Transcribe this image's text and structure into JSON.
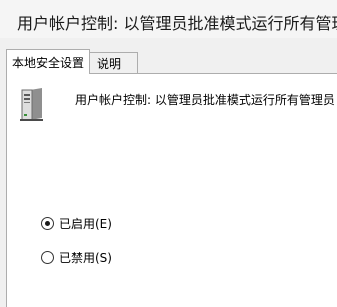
{
  "window": {
    "title": "用户帐户控制: 以管理员批准模式运行所有管理员"
  },
  "tabs": [
    {
      "label": "本地安全设置",
      "selected": true
    },
    {
      "label": "说明",
      "selected": false
    }
  ],
  "policy": {
    "icon": "server-computer-icon",
    "name": "用户帐户控制: 以管理员批准模式运行所有管理员"
  },
  "options": [
    {
      "label": "已启用(E)",
      "checked": true
    },
    {
      "label": "已禁用(S)",
      "checked": false
    }
  ]
}
